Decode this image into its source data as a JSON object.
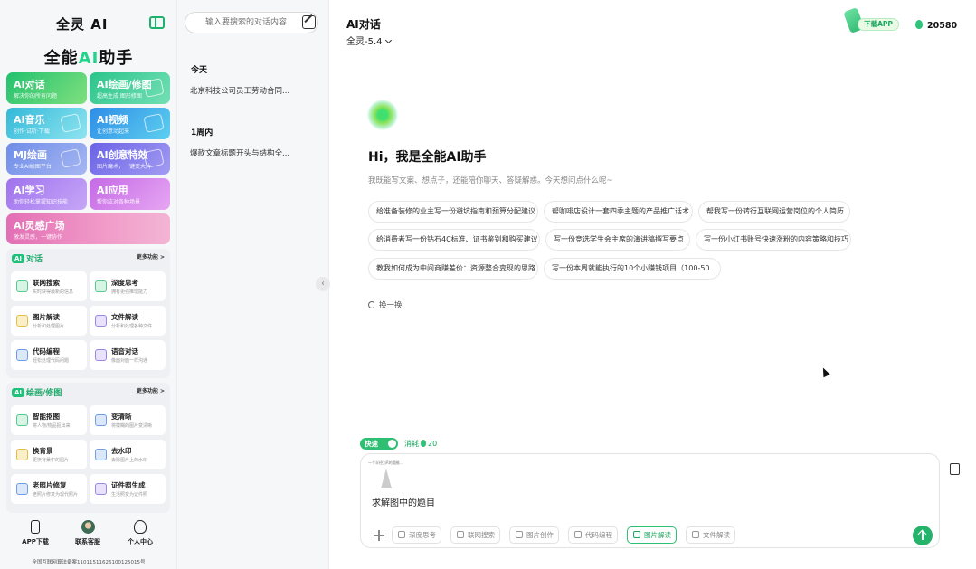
{
  "brand": {
    "name": "全灵 AI"
  },
  "slogan": {
    "pre": "全能",
    "hl": "AI",
    "post": "助手"
  },
  "features": [
    {
      "title": "AI对话",
      "sub": "解决你的所有问题"
    },
    {
      "title": "AI绘画/修图",
      "sub": "超高生成 图形修图"
    },
    {
      "title": "AI音乐",
      "sub": "创作·试听·下载"
    },
    {
      "title": "AI视频",
      "sub": "让创意动起来"
    },
    {
      "title": "MJ绘画",
      "sub": "专业AI绘图平台"
    },
    {
      "title": "AI创意特效",
      "sub": "图片魔术，一键变大片"
    },
    {
      "title": "AI学习",
      "sub": "助你轻松掌握知识技能"
    },
    {
      "title": "AI应用",
      "sub": "帮你应对各种场景"
    },
    {
      "title": "AI灵感广场",
      "sub": "激发灵感，一键协作"
    }
  ],
  "chat_section": {
    "tag": "AI",
    "title": "对话",
    "more": "更多功能 >",
    "tools": [
      {
        "title": "联网搜索",
        "sub": "实时获得最新的信息"
      },
      {
        "title": "深度思考",
        "sub": "拥有更强推理能力"
      },
      {
        "title": "图片解读",
        "sub": "分析和处理图片"
      },
      {
        "title": "文件解读",
        "sub": "分析和处理各种文件"
      },
      {
        "title": "代码编程",
        "sub": "轻松处理代码问题"
      },
      {
        "title": "语音对话",
        "sub": "像面对面一样沟通"
      }
    ]
  },
  "draw_section": {
    "tag": "AI",
    "title": "绘画/修图",
    "more": "更多功能 >",
    "tools": [
      {
        "title": "智能抠图",
        "sub": "将人物/物品抠出来"
      },
      {
        "title": "变清晰",
        "sub": "将模糊的图片变清晰"
      },
      {
        "title": "换背景",
        "sub": "更换背景中的图片"
      },
      {
        "title": "去水印",
        "sub": "去除图片上的水印"
      },
      {
        "title": "老照片修复",
        "sub": "老照片修复为现代照片"
      },
      {
        "title": "证件照生成",
        "sub": "生活照变为证件照"
      }
    ]
  },
  "bottom_nav": {
    "app": "APP下载",
    "service": "联系客服",
    "profile": "个人中心"
  },
  "icp": "全国互联网算法备案11011511626100125015号",
  "history": {
    "search_placeholder": "输入要搜索的对话内容",
    "groups": [
      {
        "label": "今天",
        "items": [
          "北京科技公司员工劳动合同..."
        ]
      },
      {
        "label": "1周内",
        "items": [
          "爆款文章标题开头与结构全..."
        ]
      }
    ]
  },
  "header": {
    "title": "AI对话",
    "model": "全灵-5.4",
    "download": "下载APP",
    "points": "20580"
  },
  "welcome": {
    "greeting": "Hi，我是全能AI助手",
    "intro": "我既能写文案、想点子，还能陪你聊天、答疑解惑。今天想问点什么呢~",
    "suggestions": [
      "给准备装修的业主写一份避坑指南和预算分配建议",
      "帮咖啡店设计一套四季主题的产品推广话术",
      "帮我写一份转行互联网运营岗位的个人简历",
      "给消费者写一份钻石4C标准、证书鉴别和购买建议",
      "写一份竞选学生会主席的演讲稿撰写要点",
      "写一份小红书账号快速涨粉的内容策略和技巧",
      "教我如何成为中间商赚差价：资源整合变现的思路",
      "写一份本周就能执行的10个小赚钱项目（100-50..."
    ],
    "refresh": "换一换"
  },
  "composer": {
    "speed_label": "快速",
    "consume_label": "消耗",
    "consume_value": "20",
    "attachment_caption": "一个半径为R的圆锥...",
    "prompt": "求解图中的题目",
    "tools": [
      "深度思考",
      "联网搜索",
      "图片创作",
      "代码编程",
      "图片解读",
      "文件解读"
    ]
  }
}
